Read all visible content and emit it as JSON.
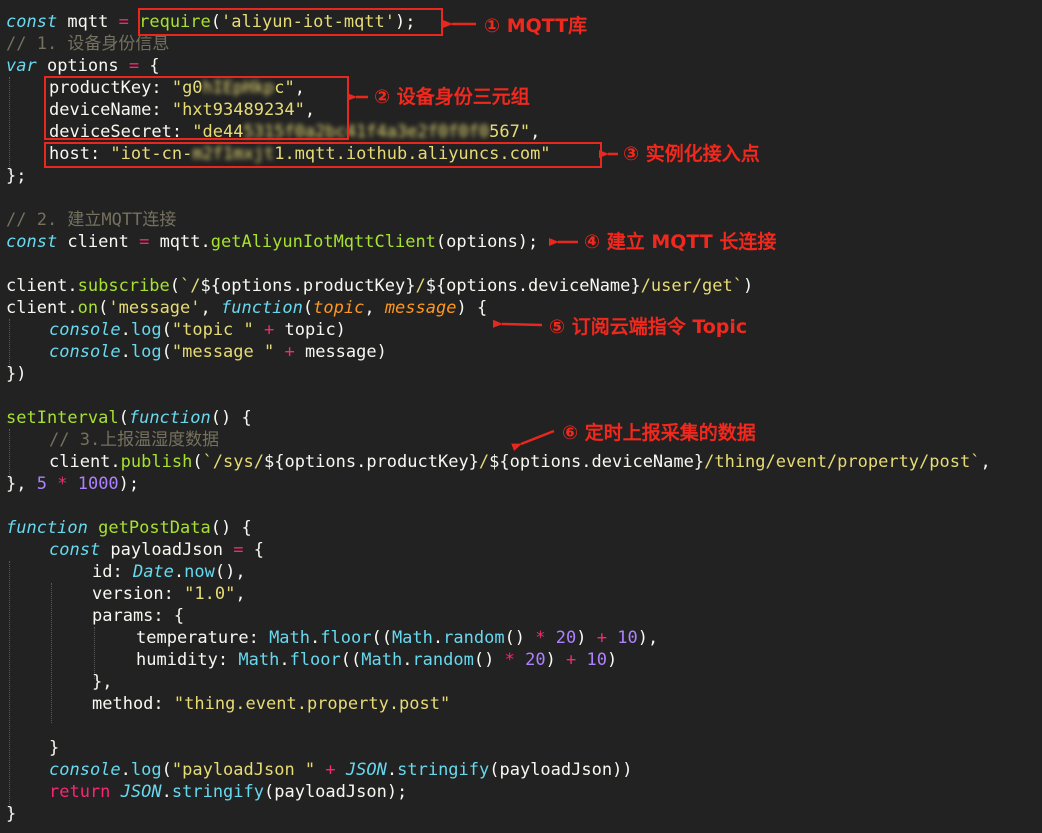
{
  "code": {
    "l1": {
      "kw": "const",
      "var": " mqtt ",
      "op": "=",
      "sp": " ",
      "fn": "require",
      "open": "(",
      "str": "'aliyun-iot-mqtt'",
      "close": ");"
    },
    "l2": "// 1. 设备身份信息",
    "l3": {
      "kw": "var",
      "rest": " options ",
      "op": "=",
      "brace": " {"
    },
    "l4": {
      "key": "productKey: ",
      "str": "\"g0",
      "blur": "hIEpHkp",
      "end": "c\"",
      "comma": ","
    },
    "l5": {
      "key": "deviceName: ",
      "str": "\"hxt93489234\"",
      "comma": ","
    },
    "l6": {
      "key": "deviceSecret: ",
      "str": "\"de44",
      "blur": "5315f0a2bc41f4a3e2f0f0f0",
      "end": "567\"",
      "comma": ","
    },
    "l7": {
      "key": "host: ",
      "str": "\"iot-cn-",
      "blur": "m2f1mxjt",
      "end": "1.mqtt.iothub.aliyuncs.com\""
    },
    "l8": "};",
    "l10": "// 2. 建立MQTT连接",
    "l11": {
      "kw": "const",
      "var": " client ",
      "op": "=",
      "obj": " mqtt.",
      "fn": "getAliyunIotMqttClient",
      "rest": "(options);"
    },
    "l13": {
      "obj": "client.",
      "fn": "subscribe",
      "open": "(",
      "s1": "`/",
      "t1": "${options.productKey}",
      "s2": "/",
      "t2": "${options.deviceName}",
      "s3": "/user/get`",
      "close": ")"
    },
    "l14": {
      "obj": "client.",
      "fn": "on",
      "open": "(",
      "str": "'message'",
      "comma": ", ",
      "kw": "function",
      "p0": "(",
      "p1": "topic",
      "pc": ", ",
      "p2": "message",
      "p3": ") {"
    },
    "l15": {
      "kw": "console",
      "dot": ".",
      "fn": "log",
      "open": "(",
      "str": "\"topic \"",
      "sp": " ",
      "op": "+",
      "rest": " topic)"
    },
    "l16": {
      "kw": "console",
      "dot": ".",
      "fn": "log",
      "open": "(",
      "str": "\"message \"",
      "sp": " ",
      "op": "+",
      "rest": " message)"
    },
    "l17": "})",
    "l19": {
      "fn": "setInterval",
      "open": "(",
      "kw": "function",
      "rest": "() {"
    },
    "l20": "// 3.上报温湿度数据",
    "l21": {
      "obj": "client.",
      "fn": "publish",
      "open": "(",
      "s1": "`/sys/",
      "t1": "${options.productKey}",
      "s2": "/",
      "t2": "${options.deviceName}",
      "s3": "/thing/event/property/post`",
      "comma": ","
    },
    "l22": {
      "pre": "}, ",
      "n1": "5",
      "sp1": " ",
      "op": "*",
      "sp2": " ",
      "n2": "1000",
      "close": ");"
    },
    "l24": {
      "kw": "function",
      "sp": " ",
      "fn": "getPostData",
      "rest": "() {"
    },
    "l25": {
      "kw": "const",
      "var": " payloadJson ",
      "op": "=",
      "brace": " {"
    },
    "l26": {
      "key": "id: ",
      "kw": "Date",
      "dot": ".",
      "fn": "now",
      "rest": "(),"
    },
    "l27": {
      "key": "version: ",
      "str": "\"1.0\"",
      "comma": ","
    },
    "l28": {
      "key": "params: {"
    },
    "l29": {
      "key": "temperature: ",
      "c1": "Math",
      "d1": ".",
      "f1": "floor",
      "o1": "((",
      "c2": "Math",
      "d2": ".",
      "f2": "random",
      "o2": "() ",
      "op1": "*",
      "sp1": " ",
      "n1": "20",
      "o3": ") ",
      "op2": "+",
      "sp2": " ",
      "n2": "10",
      "end": "),"
    },
    "l30": {
      "key": "humidity: ",
      "c1": "Math",
      "d1": ".",
      "f1": "floor",
      "o1": "((",
      "c2": "Math",
      "d2": ".",
      "f2": "random",
      "o2": "() ",
      "op1": "*",
      "sp1": " ",
      "n1": "20",
      "o3": ") ",
      "op2": "+",
      "sp2": " ",
      "n2": "10",
      "end": ")"
    },
    "l31": "},",
    "l32": {
      "key": "method: ",
      "str": "\"thing.event.property.post\""
    },
    "l34": "}",
    "l35": {
      "kw": "console",
      "dot": ".",
      "fn": "log",
      "open": "(",
      "str": "\"payloadJson \"",
      "sp": " ",
      "op": "+",
      "sp2": " ",
      "c1": "JSON",
      "d1": ".",
      "f1": "stringify",
      "rest": "(payloadJson))"
    },
    "l36": {
      "kw": "return",
      "sp": " ",
      "c1": "JSON",
      "d1": ".",
      "f1": "stringify",
      "rest": "(payloadJson);"
    },
    "l37": "}"
  },
  "annotations": {
    "a1": "① MQTT库",
    "a2": "② 设备身份三元组",
    "a3": "③ 实例化接入点",
    "a4": "④ 建立 MQTT 长连接",
    "a5": "⑤ 订阅云端指令 Topic",
    "a6": "⑥ 定时上报采集的数据"
  },
  "colors": {
    "background": "#222222",
    "annotation": "#f0281e",
    "keyword": "#66d9ef",
    "function": "#a6e22e",
    "string": "#e6db74",
    "comment": "#75715e",
    "operator": "#f92672",
    "number": "#ae81ff",
    "parameter": "#fd971f"
  }
}
